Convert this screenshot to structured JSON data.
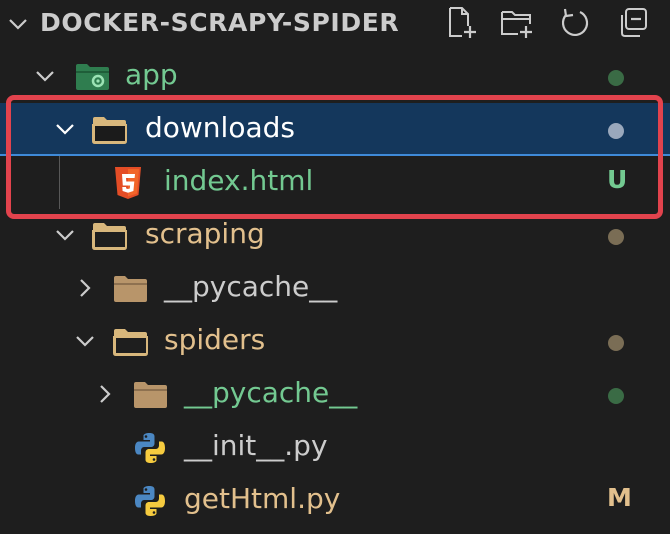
{
  "explorer": {
    "title": "DOCKER-SCRAPY-SPIDER",
    "actions": [
      {
        "name": "new-file-icon"
      },
      {
        "name": "new-folder-icon"
      },
      {
        "name": "refresh-icon"
      },
      {
        "name": "collapse-all-icon"
      }
    ]
  },
  "tree": [
    {
      "label": "app",
      "expanded": true,
      "icon": "folder-gear-icon",
      "status": "dot",
      "status_color": "#3a6b45",
      "label_color": "#73c991"
    },
    {
      "label": "downloads",
      "expanded": true,
      "icon": "folder-icon",
      "status": "dot",
      "status_color": "#9aa8bc",
      "label_color": "#ffffff",
      "selected": true
    },
    {
      "label": "index.html",
      "icon": "html5-icon",
      "status": "letter",
      "status_text": "U",
      "status_color": "#73c991",
      "label_color": "#73c991"
    },
    {
      "label": "scraping",
      "expanded": true,
      "icon": "folder-icon",
      "status": "dot",
      "status_color": "#7a6d55",
      "label_color": "#e2c08d"
    },
    {
      "label": "__pycache__",
      "expanded": false,
      "icon": "folder-icon",
      "label_color": "#cccccc"
    },
    {
      "label": "spiders",
      "expanded": true,
      "icon": "folder-icon",
      "status": "dot",
      "status_color": "#7a6d55",
      "label_color": "#e2c08d"
    },
    {
      "label": "__pycache__",
      "expanded": false,
      "icon": "folder-icon",
      "status": "dot",
      "status_color": "#3a6b45",
      "label_color": "#73c991"
    },
    {
      "label": "__init__.py",
      "icon": "python-icon",
      "label_color": "#cccccc"
    },
    {
      "label": "getHtml.py",
      "icon": "python-icon",
      "status": "letter",
      "status_text": "M",
      "status_color": "#e2c08d",
      "label_color": "#e2c08d"
    }
  ],
  "annotation": {
    "highlight_color": "#e2434d"
  }
}
